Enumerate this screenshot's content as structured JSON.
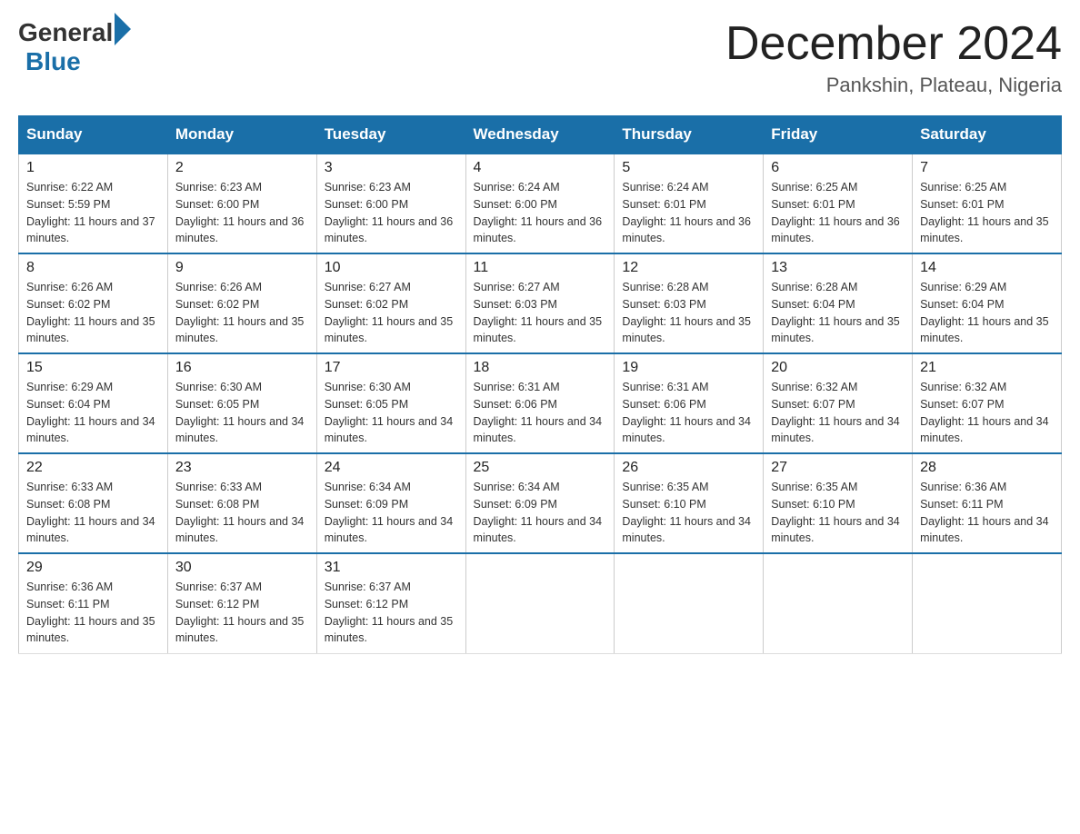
{
  "header": {
    "logo_general": "General",
    "logo_blue": "Blue",
    "title": "December 2024",
    "subtitle": "Pankshin, Plateau, Nigeria"
  },
  "columns": [
    "Sunday",
    "Monday",
    "Tuesday",
    "Wednesday",
    "Thursday",
    "Friday",
    "Saturday"
  ],
  "weeks": [
    [
      {
        "day": "1",
        "sunrise": "Sunrise: 6:22 AM",
        "sunset": "Sunset: 5:59 PM",
        "daylight": "Daylight: 11 hours and 37 minutes."
      },
      {
        "day": "2",
        "sunrise": "Sunrise: 6:23 AM",
        "sunset": "Sunset: 6:00 PM",
        "daylight": "Daylight: 11 hours and 36 minutes."
      },
      {
        "day": "3",
        "sunrise": "Sunrise: 6:23 AM",
        "sunset": "Sunset: 6:00 PM",
        "daylight": "Daylight: 11 hours and 36 minutes."
      },
      {
        "day": "4",
        "sunrise": "Sunrise: 6:24 AM",
        "sunset": "Sunset: 6:00 PM",
        "daylight": "Daylight: 11 hours and 36 minutes."
      },
      {
        "day": "5",
        "sunrise": "Sunrise: 6:24 AM",
        "sunset": "Sunset: 6:01 PM",
        "daylight": "Daylight: 11 hours and 36 minutes."
      },
      {
        "day": "6",
        "sunrise": "Sunrise: 6:25 AM",
        "sunset": "Sunset: 6:01 PM",
        "daylight": "Daylight: 11 hours and 36 minutes."
      },
      {
        "day": "7",
        "sunrise": "Sunrise: 6:25 AM",
        "sunset": "Sunset: 6:01 PM",
        "daylight": "Daylight: 11 hours and 35 minutes."
      }
    ],
    [
      {
        "day": "8",
        "sunrise": "Sunrise: 6:26 AM",
        "sunset": "Sunset: 6:02 PM",
        "daylight": "Daylight: 11 hours and 35 minutes."
      },
      {
        "day": "9",
        "sunrise": "Sunrise: 6:26 AM",
        "sunset": "Sunset: 6:02 PM",
        "daylight": "Daylight: 11 hours and 35 minutes."
      },
      {
        "day": "10",
        "sunrise": "Sunrise: 6:27 AM",
        "sunset": "Sunset: 6:02 PM",
        "daylight": "Daylight: 11 hours and 35 minutes."
      },
      {
        "day": "11",
        "sunrise": "Sunrise: 6:27 AM",
        "sunset": "Sunset: 6:03 PM",
        "daylight": "Daylight: 11 hours and 35 minutes."
      },
      {
        "day": "12",
        "sunrise": "Sunrise: 6:28 AM",
        "sunset": "Sunset: 6:03 PM",
        "daylight": "Daylight: 11 hours and 35 minutes."
      },
      {
        "day": "13",
        "sunrise": "Sunrise: 6:28 AM",
        "sunset": "Sunset: 6:04 PM",
        "daylight": "Daylight: 11 hours and 35 minutes."
      },
      {
        "day": "14",
        "sunrise": "Sunrise: 6:29 AM",
        "sunset": "Sunset: 6:04 PM",
        "daylight": "Daylight: 11 hours and 35 minutes."
      }
    ],
    [
      {
        "day": "15",
        "sunrise": "Sunrise: 6:29 AM",
        "sunset": "Sunset: 6:04 PM",
        "daylight": "Daylight: 11 hours and 34 minutes."
      },
      {
        "day": "16",
        "sunrise": "Sunrise: 6:30 AM",
        "sunset": "Sunset: 6:05 PM",
        "daylight": "Daylight: 11 hours and 34 minutes."
      },
      {
        "day": "17",
        "sunrise": "Sunrise: 6:30 AM",
        "sunset": "Sunset: 6:05 PM",
        "daylight": "Daylight: 11 hours and 34 minutes."
      },
      {
        "day": "18",
        "sunrise": "Sunrise: 6:31 AM",
        "sunset": "Sunset: 6:06 PM",
        "daylight": "Daylight: 11 hours and 34 minutes."
      },
      {
        "day": "19",
        "sunrise": "Sunrise: 6:31 AM",
        "sunset": "Sunset: 6:06 PM",
        "daylight": "Daylight: 11 hours and 34 minutes."
      },
      {
        "day": "20",
        "sunrise": "Sunrise: 6:32 AM",
        "sunset": "Sunset: 6:07 PM",
        "daylight": "Daylight: 11 hours and 34 minutes."
      },
      {
        "day": "21",
        "sunrise": "Sunrise: 6:32 AM",
        "sunset": "Sunset: 6:07 PM",
        "daylight": "Daylight: 11 hours and 34 minutes."
      }
    ],
    [
      {
        "day": "22",
        "sunrise": "Sunrise: 6:33 AM",
        "sunset": "Sunset: 6:08 PM",
        "daylight": "Daylight: 11 hours and 34 minutes."
      },
      {
        "day": "23",
        "sunrise": "Sunrise: 6:33 AM",
        "sunset": "Sunset: 6:08 PM",
        "daylight": "Daylight: 11 hours and 34 minutes."
      },
      {
        "day": "24",
        "sunrise": "Sunrise: 6:34 AM",
        "sunset": "Sunset: 6:09 PM",
        "daylight": "Daylight: 11 hours and 34 minutes."
      },
      {
        "day": "25",
        "sunrise": "Sunrise: 6:34 AM",
        "sunset": "Sunset: 6:09 PM",
        "daylight": "Daylight: 11 hours and 34 minutes."
      },
      {
        "day": "26",
        "sunrise": "Sunrise: 6:35 AM",
        "sunset": "Sunset: 6:10 PM",
        "daylight": "Daylight: 11 hours and 34 minutes."
      },
      {
        "day": "27",
        "sunrise": "Sunrise: 6:35 AM",
        "sunset": "Sunset: 6:10 PM",
        "daylight": "Daylight: 11 hours and 34 minutes."
      },
      {
        "day": "28",
        "sunrise": "Sunrise: 6:36 AM",
        "sunset": "Sunset: 6:11 PM",
        "daylight": "Daylight: 11 hours and 34 minutes."
      }
    ],
    [
      {
        "day": "29",
        "sunrise": "Sunrise: 6:36 AM",
        "sunset": "Sunset: 6:11 PM",
        "daylight": "Daylight: 11 hours and 35 minutes."
      },
      {
        "day": "30",
        "sunrise": "Sunrise: 6:37 AM",
        "sunset": "Sunset: 6:12 PM",
        "daylight": "Daylight: 11 hours and 35 minutes."
      },
      {
        "day": "31",
        "sunrise": "Sunrise: 6:37 AM",
        "sunset": "Sunset: 6:12 PM",
        "daylight": "Daylight: 11 hours and 35 minutes."
      },
      null,
      null,
      null,
      null
    ]
  ]
}
